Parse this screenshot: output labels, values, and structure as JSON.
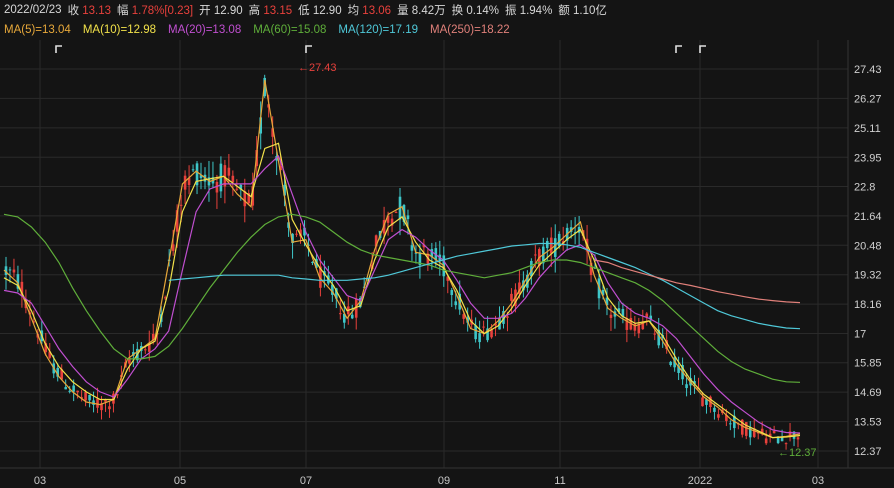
{
  "header": {
    "date": "2022/02/23",
    "close_label": "收",
    "close_value": "13.13",
    "change_label": "幅",
    "change_value": "1.78%[0.23]",
    "open_label": "开",
    "open_value": "12.90",
    "high_label": "高",
    "high_value": "13.15",
    "low_label": "低",
    "low_value": "12.90",
    "avg_label": "均",
    "avg_value": "13.06",
    "volume_label": "量",
    "volume_value": "8.42万",
    "turnover_label": "换",
    "turnover_value": "0.14%",
    "amplitude_label": "振",
    "amplitude_value": "1.94%",
    "amount_label": "额",
    "amount_value": "1.10亿"
  },
  "ma_legend": [
    {
      "label": "MA(5)=13.04",
      "color": "#e7a83a"
    },
    {
      "label": "MA(10)=12.98",
      "color": "#f2e24a"
    },
    {
      "label": "MA(20)=13.08",
      "color": "#c04fd0"
    },
    {
      "label": "MA(60)=15.08",
      "color": "#5fae3a"
    },
    {
      "label": "MA(120)=17.19",
      "color": "#4fc8d8"
    },
    {
      "label": "MA(250)=18.22",
      "color": "#e0807a"
    }
  ],
  "colors": {
    "up": "#e8413c",
    "down": "#3ec6c8",
    "background": "#141414",
    "grid": "#2a2a2a"
  },
  "chart_data": {
    "type": "candlestick",
    "y_ticks": [
      "27.43",
      "26.27",
      "25.11",
      "23.95",
      "22.8",
      "21.64",
      "20.48",
      "19.32",
      "18.16",
      "17",
      "15.85",
      "14.69",
      "13.53",
      "12.37"
    ],
    "ylim": [
      12.37,
      27.43
    ],
    "x_ticks": [
      "03",
      "05",
      "07",
      "09",
      "11",
      "2022",
      "03"
    ],
    "annotations": {
      "high": "27.43",
      "low": "12.37",
      "high_marker": "←27.43",
      "low_marker": "←12.37"
    },
    "series": [
      {
        "name": "MA(5)",
        "key": "ma5",
        "color": "#e7a83a",
        "values": [
          19.5,
          19.0,
          17.6,
          16.2,
          15.3,
          14.7,
          14.3,
          14.2,
          14.4,
          16.0,
          16.4,
          16.8,
          19.8,
          22.9,
          23.4,
          23.0,
          23.2,
          22.5,
          22.0,
          27.0,
          23.8,
          20.6,
          20.7,
          19.2,
          18.6,
          17.6,
          18.3,
          20.3,
          21.7,
          22.0,
          20.2,
          20.1,
          19.7,
          18.5,
          17.2,
          17.0,
          17.5,
          18.2,
          19.1,
          20.0,
          20.4,
          20.9,
          21.4,
          19.3,
          18.0,
          17.6,
          17.3,
          17.5,
          16.7,
          15.8,
          15.1,
          14.5,
          14.1,
          13.6,
          13.3,
          13.1,
          12.9,
          12.95,
          13.04
        ]
      },
      {
        "name": "MA(10)",
        "key": "ma10",
        "color": "#f2e24a",
        "values": [
          19.2,
          18.9,
          17.9,
          16.6,
          15.7,
          15.1,
          14.7,
          14.4,
          14.4,
          15.6,
          16.4,
          16.7,
          18.7,
          21.8,
          23.0,
          23.1,
          23.2,
          22.8,
          22.4,
          24.3,
          24.5,
          21.5,
          20.5,
          19.6,
          18.9,
          17.9,
          18.1,
          19.9,
          21.2,
          21.6,
          20.6,
          19.9,
          19.6,
          18.7,
          17.5,
          17.0,
          17.3,
          18.0,
          18.9,
          19.7,
          20.2,
          20.7,
          21.1,
          19.9,
          18.4,
          17.7,
          17.4,
          17.5,
          16.9,
          16.0,
          15.2,
          14.6,
          14.2,
          13.8,
          13.4,
          13.15,
          12.9,
          12.92,
          12.98
        ]
      },
      {
        "name": "MA(20)",
        "key": "ma20",
        "color": "#c04fd0",
        "values": [
          18.7,
          18.6,
          18.2,
          17.3,
          16.4,
          15.7,
          15.1,
          14.7,
          14.5,
          15.2,
          16.0,
          16.4,
          17.1,
          19.5,
          21.8,
          22.7,
          22.9,
          22.9,
          22.9,
          23.5,
          24.0,
          22.5,
          21.0,
          19.9,
          19.2,
          18.5,
          18.3,
          19.5,
          20.7,
          21.1,
          20.8,
          20.3,
          19.9,
          19.1,
          18.2,
          17.6,
          17.6,
          17.8,
          18.4,
          19.2,
          19.8,
          20.3,
          20.5,
          20.1,
          19.0,
          18.2,
          17.8,
          17.6,
          17.3,
          16.8,
          16.1,
          15.4,
          14.8,
          14.3,
          13.9,
          13.5,
          13.2,
          13.1,
          13.08
        ]
      },
      {
        "name": "MA(60)",
        "key": "ma60",
        "color": "#5fae3a",
        "values": [
          21.7,
          21.6,
          21.2,
          20.6,
          19.8,
          18.8,
          17.9,
          17.1,
          16.4,
          16.0,
          16.0,
          16.1,
          16.5,
          17.2,
          18.0,
          18.8,
          19.5,
          20.2,
          20.8,
          21.3,
          21.6,
          21.7,
          21.6,
          21.4,
          21.0,
          20.6,
          20.3,
          20.1,
          20.0,
          19.9,
          19.8,
          19.7,
          19.5,
          19.4,
          19.3,
          19.2,
          19.3,
          19.4,
          19.6,
          19.8,
          19.9,
          19.9,
          19.8,
          19.6,
          19.4,
          19.2,
          19.0,
          18.7,
          18.3,
          17.8,
          17.3,
          16.8,
          16.3,
          15.9,
          15.6,
          15.4,
          15.2,
          15.1,
          15.08
        ]
      },
      {
        "name": "MA(120)",
        "key": "ma120",
        "color": "#4fc8d8",
        "values": [
          null,
          null,
          null,
          null,
          null,
          null,
          null,
          null,
          null,
          null,
          null,
          null,
          19.1,
          19.15,
          19.2,
          19.25,
          19.3,
          19.3,
          19.3,
          19.3,
          19.3,
          19.2,
          19.15,
          19.1,
          19.1,
          19.1,
          19.15,
          19.2,
          19.3,
          19.45,
          19.6,
          19.75,
          19.9,
          20.05,
          20.15,
          20.25,
          20.35,
          20.45,
          20.5,
          20.55,
          20.55,
          20.5,
          20.4,
          20.2,
          20.0,
          19.8,
          19.6,
          19.35,
          19.1,
          18.8,
          18.5,
          18.2,
          17.9,
          17.7,
          17.55,
          17.4,
          17.3,
          17.22,
          17.19
        ]
      },
      {
        "name": "MA(250)",
        "key": "ma250",
        "color": "#e0807a",
        "values": [
          null,
          null,
          null,
          null,
          null,
          null,
          null,
          null,
          null,
          null,
          null,
          null,
          null,
          null,
          null,
          null,
          null,
          null,
          null,
          null,
          null,
          null,
          null,
          null,
          null,
          null,
          null,
          null,
          null,
          null,
          null,
          null,
          null,
          null,
          null,
          null,
          null,
          null,
          null,
          null,
          null,
          null,
          null,
          19.9,
          19.8,
          19.6,
          19.45,
          19.3,
          19.15,
          19.0,
          18.9,
          18.78,
          18.65,
          18.55,
          18.45,
          18.36,
          18.3,
          18.25,
          18.22
        ]
      }
    ]
  }
}
